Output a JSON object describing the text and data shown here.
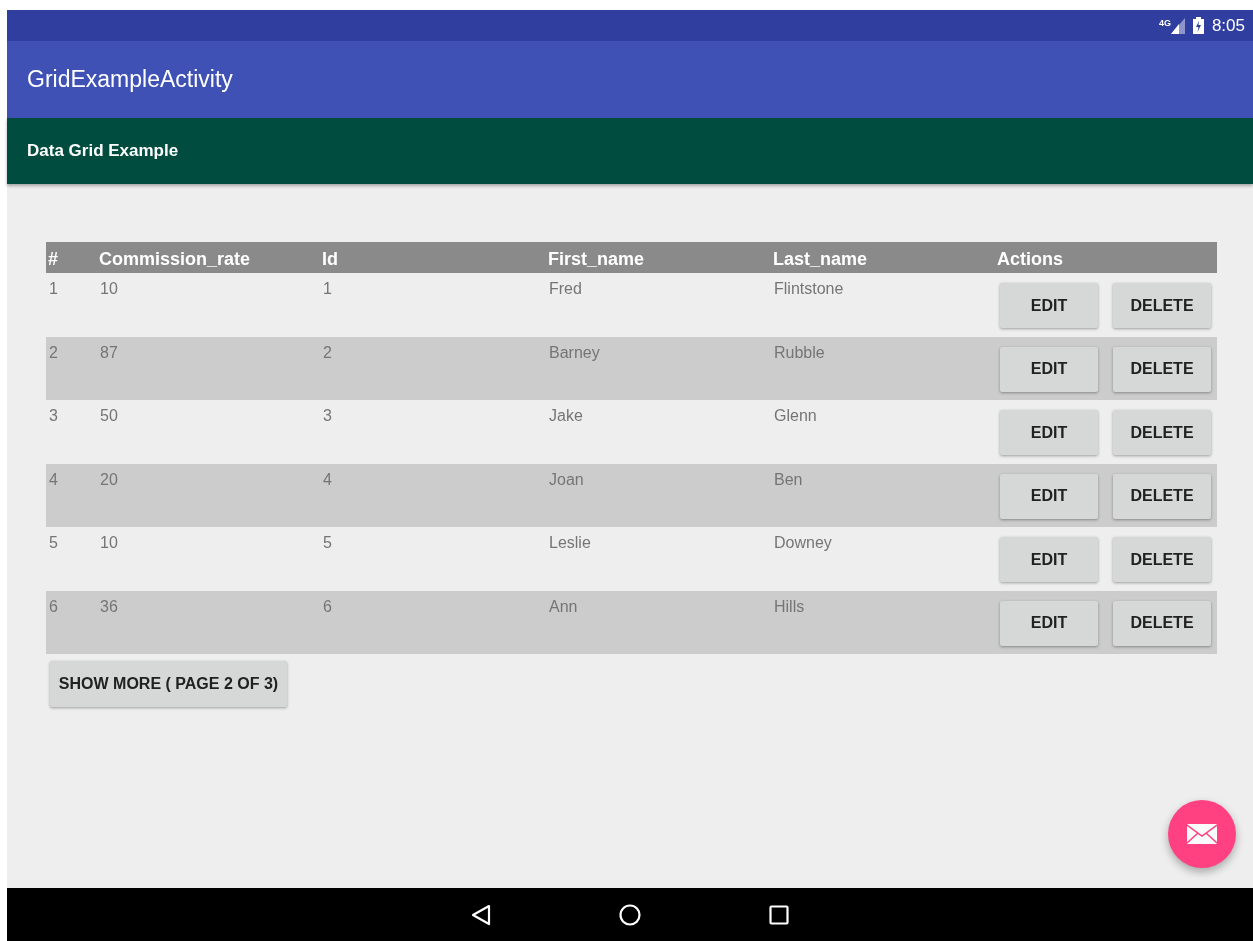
{
  "status_bar": {
    "network": "4G",
    "time": "8:05"
  },
  "app_bar": {
    "title": "GridExampleActivity"
  },
  "sub_header": {
    "title": "Data Grid Example"
  },
  "table": {
    "columns": [
      "#",
      "Commission_rate",
      "Id",
      "First_name",
      "Last_name",
      "Actions"
    ],
    "rows": [
      {
        "cells": [
          "1",
          "10",
          "1",
          "Fred",
          "Flintstone"
        ],
        "actions": [
          "EDIT",
          "DELETE"
        ]
      },
      {
        "cells": [
          "2",
          "87",
          "2",
          "Barney",
          "Rubble"
        ],
        "actions": [
          "EDIT",
          "DELETE"
        ]
      },
      {
        "cells": [
          "3",
          "50",
          "3",
          "Jake",
          "Glenn"
        ],
        "actions": [
          "EDIT",
          "DELETE"
        ]
      },
      {
        "cells": [
          "4",
          "20",
          "4",
          "Joan",
          "Ben"
        ],
        "actions": [
          "EDIT",
          "DELETE"
        ]
      },
      {
        "cells": [
          "5",
          "10",
          "5",
          "Leslie",
          "Downey"
        ],
        "actions": [
          "EDIT",
          "DELETE"
        ]
      },
      {
        "cells": [
          "6",
          "36",
          "6",
          "Ann",
          "Hills"
        ],
        "actions": [
          "EDIT",
          "DELETE"
        ]
      }
    ]
  },
  "show_more_button": "SHOW MORE ( PAGE 2 OF 3)"
}
